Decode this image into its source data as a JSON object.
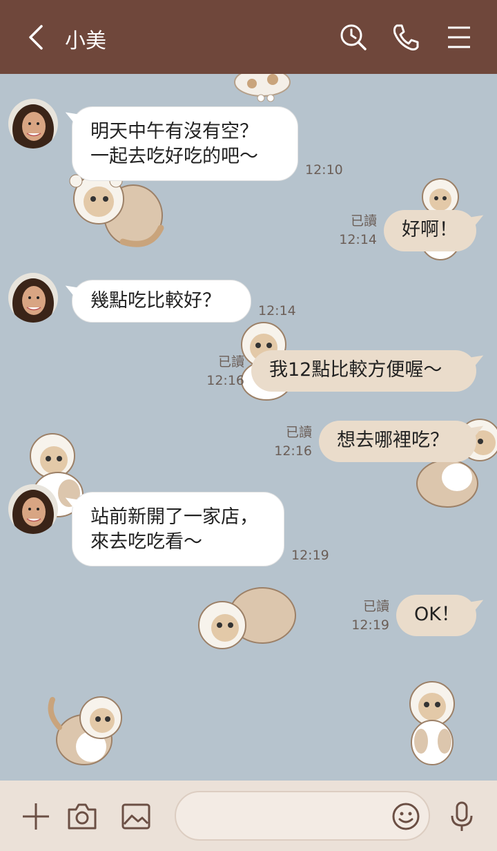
{
  "header": {
    "contact_name": "小美"
  },
  "icons": {
    "back": "chevron-left-icon",
    "search": "search-clock-icon",
    "call": "phone-icon",
    "menu": "hamburger-menu-icon",
    "add": "plus-icon",
    "camera": "camera-icon",
    "image": "image-icon",
    "emoji": "smiley-icon",
    "mic": "microphone-icon"
  },
  "colors": {
    "header_bg": "#6f473b",
    "chat_bg": "#b6c3cd",
    "incoming_bubble": "#ffffff",
    "outgoing_bubble": "#eadccb",
    "bottom_bar": "#ebe1d8"
  },
  "messages": [
    {
      "from": "friend",
      "lines": [
        "明天中午有沒有空？",
        "一起去吃好吃的吧～"
      ],
      "time": "12:10"
    },
    {
      "from": "me",
      "text": "好啊！",
      "read": "已讀",
      "time": "12:14"
    },
    {
      "from": "friend",
      "lines": [
        "幾點吃比較好？"
      ],
      "time": "12:14"
    },
    {
      "from": "me",
      "text": "我12點比較方便喔～",
      "read": "已讀",
      "time": "12:16"
    },
    {
      "from": "me",
      "text": "想去哪裡吃？",
      "read": "已讀",
      "time": "12:16"
    },
    {
      "from": "friend",
      "lines": [
        "站前新開了一家店，",
        "來去吃吃看～"
      ],
      "time": "12:19"
    },
    {
      "from": "me",
      "text": "OK！",
      "read": "已讀",
      "time": "12:19"
    }
  ],
  "composer": {
    "placeholder": ""
  }
}
